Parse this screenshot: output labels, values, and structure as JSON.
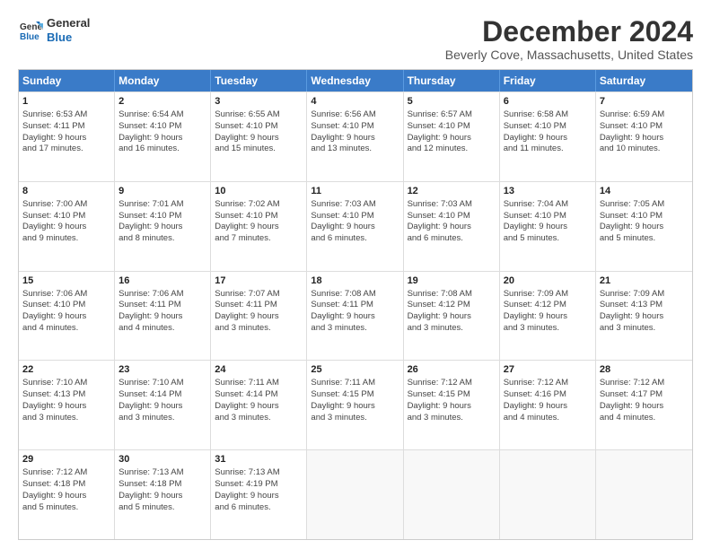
{
  "header": {
    "logo_line1": "General",
    "logo_line2": "Blue",
    "title": "December 2024",
    "subtitle": "Beverly Cove, Massachusetts, United States"
  },
  "weekdays": [
    "Sunday",
    "Monday",
    "Tuesday",
    "Wednesday",
    "Thursday",
    "Friday",
    "Saturday"
  ],
  "weeks": [
    [
      {
        "day": "1",
        "line1": "Sunrise: 6:53 AM",
        "line2": "Sunset: 4:11 PM",
        "line3": "Daylight: 9 hours",
        "line4": "and 17 minutes."
      },
      {
        "day": "2",
        "line1": "Sunrise: 6:54 AM",
        "line2": "Sunset: 4:10 PM",
        "line3": "Daylight: 9 hours",
        "line4": "and 16 minutes."
      },
      {
        "day": "3",
        "line1": "Sunrise: 6:55 AM",
        "line2": "Sunset: 4:10 PM",
        "line3": "Daylight: 9 hours",
        "line4": "and 15 minutes."
      },
      {
        "day": "4",
        "line1": "Sunrise: 6:56 AM",
        "line2": "Sunset: 4:10 PM",
        "line3": "Daylight: 9 hours",
        "line4": "and 13 minutes."
      },
      {
        "day": "5",
        "line1": "Sunrise: 6:57 AM",
        "line2": "Sunset: 4:10 PM",
        "line3": "Daylight: 9 hours",
        "line4": "and 12 minutes."
      },
      {
        "day": "6",
        "line1": "Sunrise: 6:58 AM",
        "line2": "Sunset: 4:10 PM",
        "line3": "Daylight: 9 hours",
        "line4": "and 11 minutes."
      },
      {
        "day": "7",
        "line1": "Sunrise: 6:59 AM",
        "line2": "Sunset: 4:10 PM",
        "line3": "Daylight: 9 hours",
        "line4": "and 10 minutes."
      }
    ],
    [
      {
        "day": "8",
        "line1": "Sunrise: 7:00 AM",
        "line2": "Sunset: 4:10 PM",
        "line3": "Daylight: 9 hours",
        "line4": "and 9 minutes."
      },
      {
        "day": "9",
        "line1": "Sunrise: 7:01 AM",
        "line2": "Sunset: 4:10 PM",
        "line3": "Daylight: 9 hours",
        "line4": "and 8 minutes."
      },
      {
        "day": "10",
        "line1": "Sunrise: 7:02 AM",
        "line2": "Sunset: 4:10 PM",
        "line3": "Daylight: 9 hours",
        "line4": "and 7 minutes."
      },
      {
        "day": "11",
        "line1": "Sunrise: 7:03 AM",
        "line2": "Sunset: 4:10 PM",
        "line3": "Daylight: 9 hours",
        "line4": "and 6 minutes."
      },
      {
        "day": "12",
        "line1": "Sunrise: 7:03 AM",
        "line2": "Sunset: 4:10 PM",
        "line3": "Daylight: 9 hours",
        "line4": "and 6 minutes."
      },
      {
        "day": "13",
        "line1": "Sunrise: 7:04 AM",
        "line2": "Sunset: 4:10 PM",
        "line3": "Daylight: 9 hours",
        "line4": "and 5 minutes."
      },
      {
        "day": "14",
        "line1": "Sunrise: 7:05 AM",
        "line2": "Sunset: 4:10 PM",
        "line3": "Daylight: 9 hours",
        "line4": "and 5 minutes."
      }
    ],
    [
      {
        "day": "15",
        "line1": "Sunrise: 7:06 AM",
        "line2": "Sunset: 4:10 PM",
        "line3": "Daylight: 9 hours",
        "line4": "and 4 minutes."
      },
      {
        "day": "16",
        "line1": "Sunrise: 7:06 AM",
        "line2": "Sunset: 4:11 PM",
        "line3": "Daylight: 9 hours",
        "line4": "and 4 minutes."
      },
      {
        "day": "17",
        "line1": "Sunrise: 7:07 AM",
        "line2": "Sunset: 4:11 PM",
        "line3": "Daylight: 9 hours",
        "line4": "and 3 minutes."
      },
      {
        "day": "18",
        "line1": "Sunrise: 7:08 AM",
        "line2": "Sunset: 4:11 PM",
        "line3": "Daylight: 9 hours",
        "line4": "and 3 minutes."
      },
      {
        "day": "19",
        "line1": "Sunrise: 7:08 AM",
        "line2": "Sunset: 4:12 PM",
        "line3": "Daylight: 9 hours",
        "line4": "and 3 minutes."
      },
      {
        "day": "20",
        "line1": "Sunrise: 7:09 AM",
        "line2": "Sunset: 4:12 PM",
        "line3": "Daylight: 9 hours",
        "line4": "and 3 minutes."
      },
      {
        "day": "21",
        "line1": "Sunrise: 7:09 AM",
        "line2": "Sunset: 4:13 PM",
        "line3": "Daylight: 9 hours",
        "line4": "and 3 minutes."
      }
    ],
    [
      {
        "day": "22",
        "line1": "Sunrise: 7:10 AM",
        "line2": "Sunset: 4:13 PM",
        "line3": "Daylight: 9 hours",
        "line4": "and 3 minutes."
      },
      {
        "day": "23",
        "line1": "Sunrise: 7:10 AM",
        "line2": "Sunset: 4:14 PM",
        "line3": "Daylight: 9 hours",
        "line4": "and 3 minutes."
      },
      {
        "day": "24",
        "line1": "Sunrise: 7:11 AM",
        "line2": "Sunset: 4:14 PM",
        "line3": "Daylight: 9 hours",
        "line4": "and 3 minutes."
      },
      {
        "day": "25",
        "line1": "Sunrise: 7:11 AM",
        "line2": "Sunset: 4:15 PM",
        "line3": "Daylight: 9 hours",
        "line4": "and 3 minutes."
      },
      {
        "day": "26",
        "line1": "Sunrise: 7:12 AM",
        "line2": "Sunset: 4:15 PM",
        "line3": "Daylight: 9 hours",
        "line4": "and 3 minutes."
      },
      {
        "day": "27",
        "line1": "Sunrise: 7:12 AM",
        "line2": "Sunset: 4:16 PM",
        "line3": "Daylight: 9 hours",
        "line4": "and 4 minutes."
      },
      {
        "day": "28",
        "line1": "Sunrise: 7:12 AM",
        "line2": "Sunset: 4:17 PM",
        "line3": "Daylight: 9 hours",
        "line4": "and 4 minutes."
      }
    ],
    [
      {
        "day": "29",
        "line1": "Sunrise: 7:12 AM",
        "line2": "Sunset: 4:18 PM",
        "line3": "Daylight: 9 hours",
        "line4": "and 5 minutes."
      },
      {
        "day": "30",
        "line1": "Sunrise: 7:13 AM",
        "line2": "Sunset: 4:18 PM",
        "line3": "Daylight: 9 hours",
        "line4": "and 5 minutes."
      },
      {
        "day": "31",
        "line1": "Sunrise: 7:13 AM",
        "line2": "Sunset: 4:19 PM",
        "line3": "Daylight: 9 hours",
        "line4": "and 6 minutes."
      },
      {
        "day": "",
        "line1": "",
        "line2": "",
        "line3": "",
        "line4": ""
      },
      {
        "day": "",
        "line1": "",
        "line2": "",
        "line3": "",
        "line4": ""
      },
      {
        "day": "",
        "line1": "",
        "line2": "",
        "line3": "",
        "line4": ""
      },
      {
        "day": "",
        "line1": "",
        "line2": "",
        "line3": "",
        "line4": ""
      }
    ]
  ]
}
